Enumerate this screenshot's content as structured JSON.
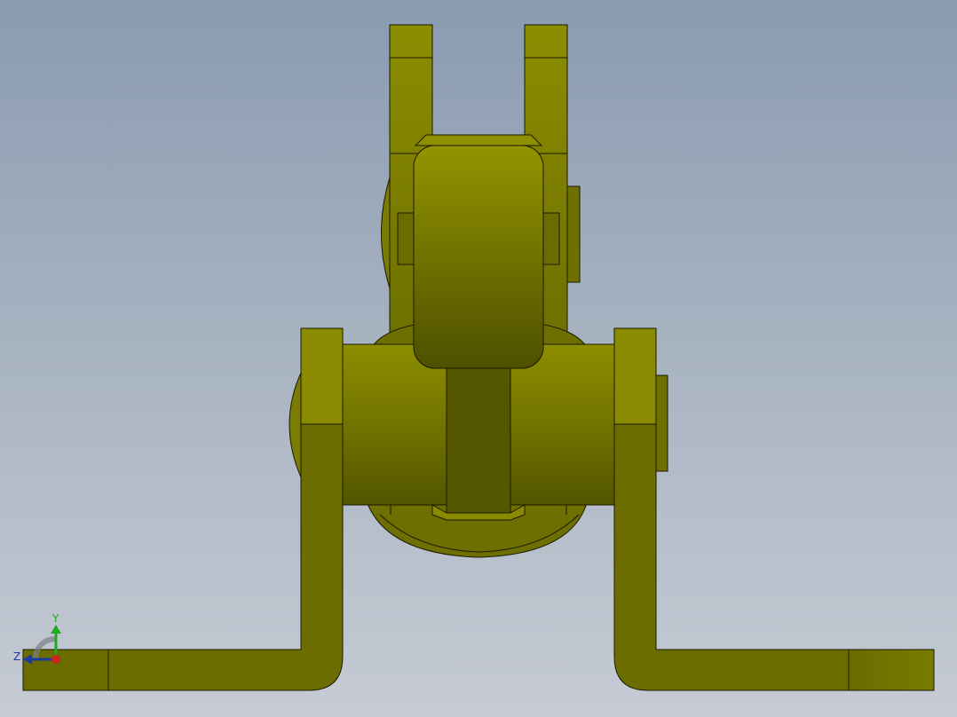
{
  "viewport": {
    "background_top": "#8a9bb0",
    "background_bottom": "#c6cbd4"
  },
  "model": {
    "part_color": "#8f9000",
    "part_dark": "#4f5000",
    "edge_color": "#1a1a00"
  },
  "triad": {
    "y_label": "Y",
    "z_label": "Z",
    "y_color": "#1faa1f",
    "z_color": "#1a3aa8",
    "x_color": "#cc2222"
  }
}
